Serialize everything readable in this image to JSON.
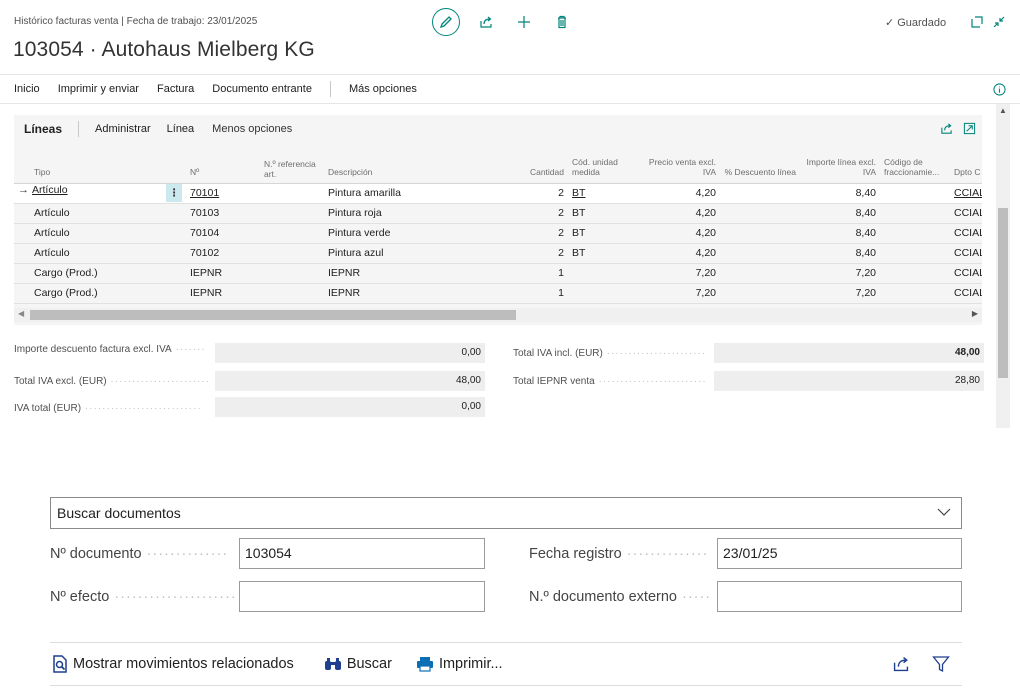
{
  "header": {
    "subtitle": "Histórico facturas venta | Fecha de trabajo: 23/01/2025",
    "title": "103054 · Autohaus Mielberg KG",
    "saved_label": "Guardado"
  },
  "actions": {
    "items": [
      "Inicio",
      "Imprimir y enviar",
      "Factura",
      "Documento entrante"
    ],
    "more": "Más opciones"
  },
  "lines": {
    "tab_main": "Líneas",
    "tabs": [
      "Administrar",
      "Línea",
      "Menos opciones"
    ],
    "columns": {
      "tipo": "Tipo",
      "no": "Nº",
      "ref": "N.º referencia art.",
      "desc": "Descripción",
      "qty": "Cantidad",
      "uom": "Cód. unidad medida",
      "price": "Precio venta excl. IVA",
      "disc": "% Descuento línea",
      "amount": "Importe línea excl. IVA",
      "frac": "Código de fraccionamie...",
      "dept": "Dpto C"
    },
    "rows": [
      {
        "tipo": "Artículo",
        "no": "70101",
        "desc": "Pintura amarilla",
        "qty": "2",
        "uom": "BT",
        "price": "4,20",
        "amount": "8,40",
        "dept": "CCIAL"
      },
      {
        "tipo": "Artículo",
        "no": "70103",
        "desc": "Pintura roja",
        "qty": "2",
        "uom": "BT",
        "price": "4,20",
        "amount": "8,40",
        "dept": "CCIAL"
      },
      {
        "tipo": "Artículo",
        "no": "70104",
        "desc": "Pintura verde",
        "qty": "2",
        "uom": "BT",
        "price": "4,20",
        "amount": "8,40",
        "dept": "CCIAL"
      },
      {
        "tipo": "Artículo",
        "no": "70102",
        "desc": "Pintura azul",
        "qty": "2",
        "uom": "BT",
        "price": "4,20",
        "amount": "8,40",
        "dept": "CCIAL"
      },
      {
        "tipo": "Cargo (Prod.)",
        "no": "IEPNR",
        "desc": "IEPNR",
        "qty": "1",
        "uom": "",
        "price": "7,20",
        "amount": "7,20",
        "dept": "CCIAL"
      },
      {
        "tipo": "Cargo (Prod.)",
        "no": "IEPNR",
        "desc": "IEPNR",
        "qty": "1",
        "uom": "",
        "price": "7,20",
        "amount": "7,20",
        "dept": "CCIAL"
      }
    ]
  },
  "totals": {
    "discount_label": "Importe descuento factura excl. IVA",
    "discount_value": "0,00",
    "excl_label": "Total IVA excl. (EUR)",
    "excl_value": "48,00",
    "vat_label": "IVA total (EUR)",
    "vat_value": "0,00",
    "incl_label": "Total IVA incl. (EUR)",
    "incl_value": "48,00",
    "iepnr_label": "Total IEPNR venta",
    "iepnr_value": "28,80"
  },
  "search_docs": {
    "select_value": "Buscar documentos",
    "doc_no_label": "Nº documento",
    "doc_no_value": "103054",
    "post_date_label": "Fecha registro",
    "post_date_value": "23/01/25",
    "effect_label": "Nº efecto",
    "effect_value": "",
    "ext_doc_label": "N.º documento externo",
    "ext_doc_value": "",
    "show_related": "Mostrar movimientos relacionados",
    "search_btn": "Buscar",
    "print_btn": "Imprimir..."
  },
  "colors": {
    "accent": "#00857a",
    "search_icon_blue": "#1f3f8f",
    "print_icon_blue": "#0b6fb5"
  }
}
